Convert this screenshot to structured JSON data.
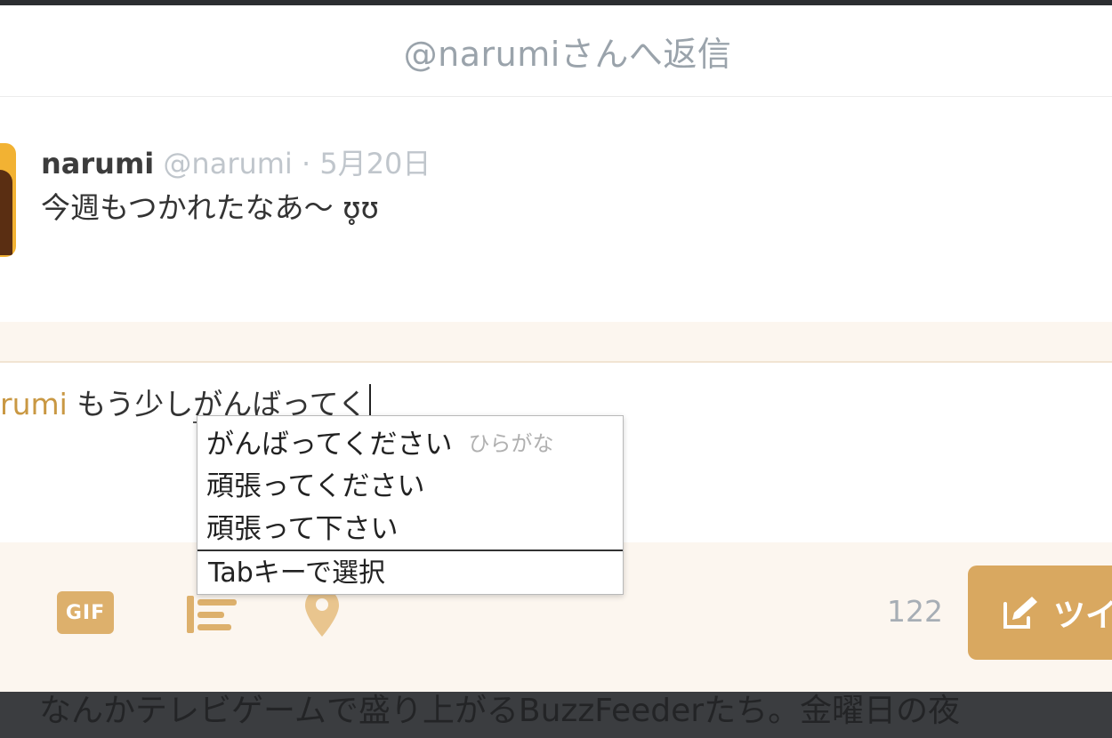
{
  "dialog": {
    "title": "@narumiさんへ返信"
  },
  "tweet": {
    "author_name": "narumi",
    "author_handle": "@narumi",
    "separator": "·",
    "date": "5月20日",
    "text": "今週もつかれたなあ〜 ʊ̥ʊ"
  },
  "composer": {
    "mention_fragment": "rumi",
    "typed_text": " もう少し",
    "ime_composing_text": "がんばってく"
  },
  "ime_candidates": {
    "items": [
      {
        "text": "がんばってください",
        "hint": "ひらがな"
      },
      {
        "text": "頑張ってください",
        "hint": ""
      },
      {
        "text": "頑張って下さい",
        "hint": ""
      }
    ],
    "footer": "Tabキーで選択"
  },
  "toolbar": {
    "gif_label": "GIF",
    "char_count": "122",
    "tweet_button_label": "ツイ",
    "accent_color": "#d9a860"
  },
  "background": {
    "text": "なんかテレビゲームで盛り上がるBuzzFeederたち。金曜日の夜"
  }
}
